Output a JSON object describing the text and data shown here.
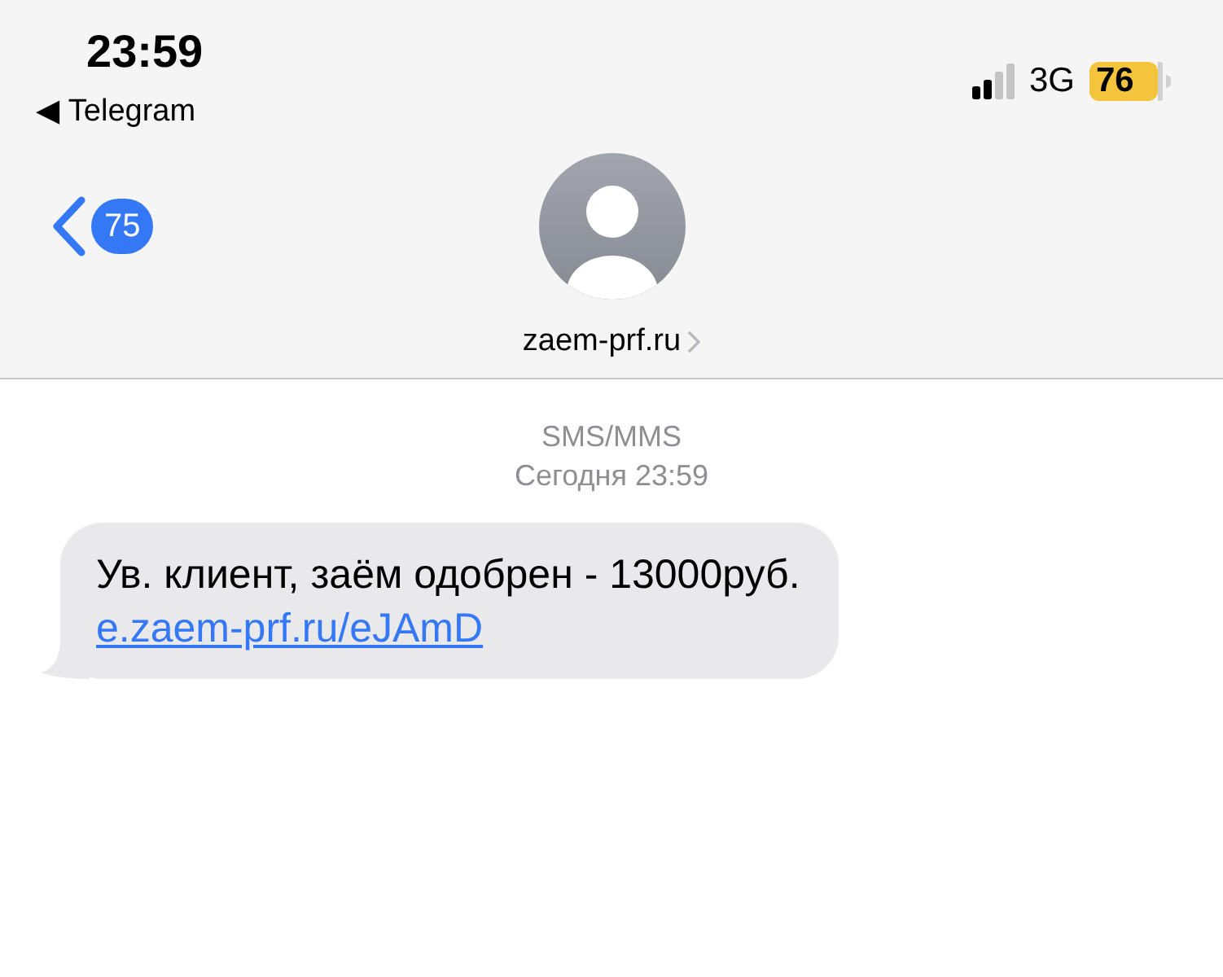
{
  "status_bar": {
    "time": "23:59",
    "back_app": "◀ Telegram",
    "network": "3G",
    "battery": "76"
  },
  "header": {
    "back_count": "75",
    "contact": "zaem-prf.ru"
  },
  "conversation": {
    "service": "SMS/MMS",
    "date": "Сегодня 23:59",
    "messages": [
      {
        "text": "Ув. клиент, заём одобрен - 13000руб.",
        "link": "e.zaem-prf.ru/eJAmD"
      }
    ]
  }
}
